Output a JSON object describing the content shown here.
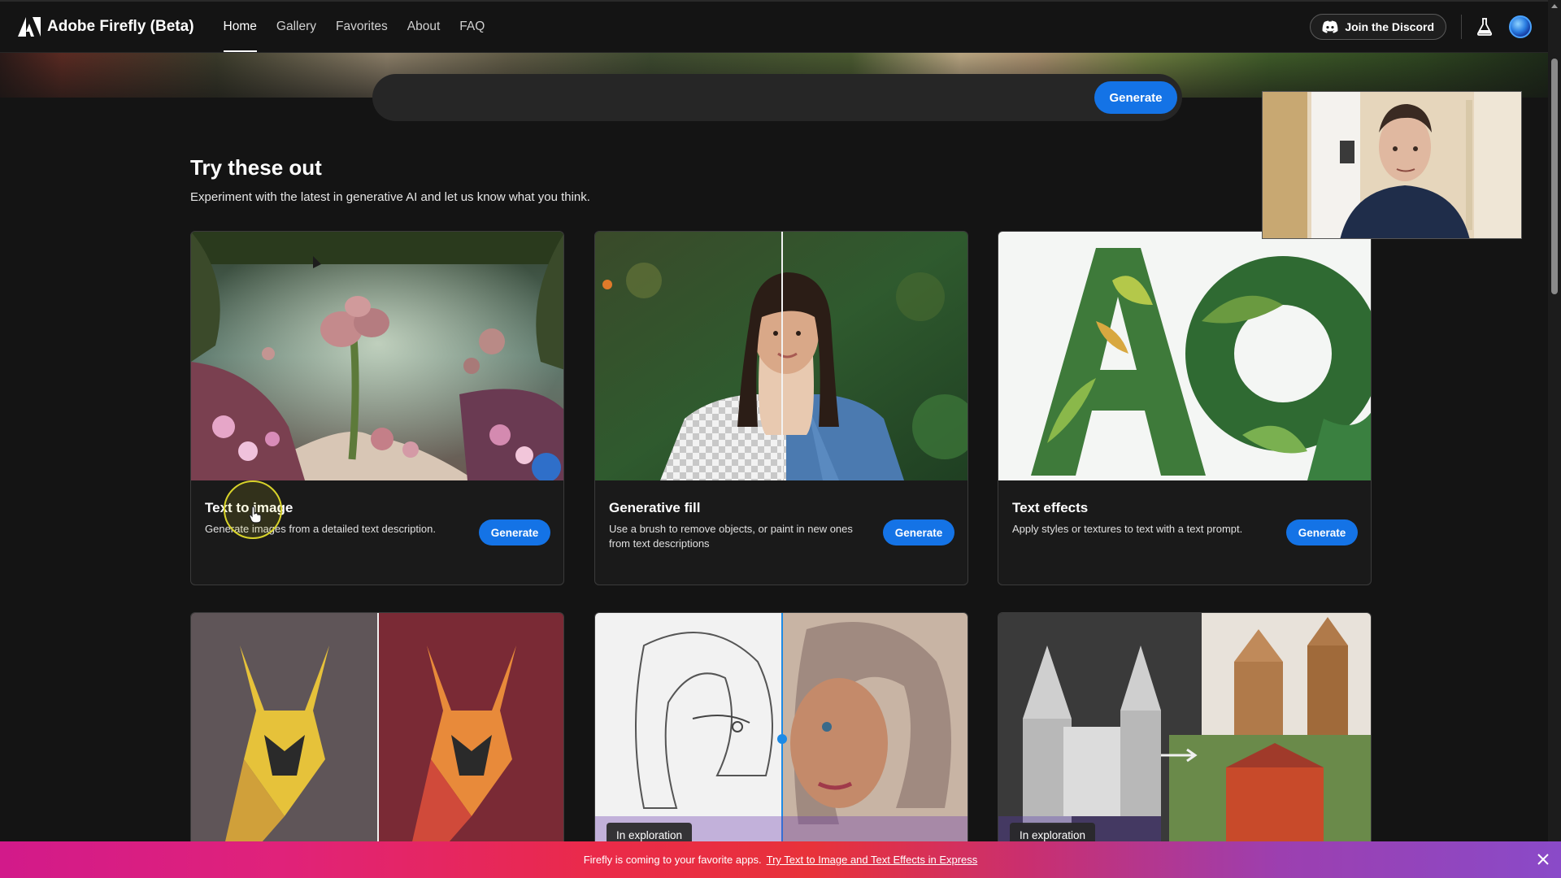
{
  "app": {
    "brand": "Adobe Firefly (Beta)"
  },
  "nav": {
    "links": [
      {
        "label": "Home",
        "active": true
      },
      {
        "label": "Gallery",
        "active": false
      },
      {
        "label": "Favorites",
        "active": false
      },
      {
        "label": "About",
        "active": false
      },
      {
        "label": "FAQ",
        "active": false
      }
    ],
    "discord_label": "Join the Discord"
  },
  "prompt": {
    "placeholder": "",
    "generate_label": "Generate"
  },
  "section": {
    "title": "Try these out",
    "subtitle": "Experiment with the latest in generative AI and let us know what you think."
  },
  "cards": [
    {
      "title": "Text to image",
      "desc": "Generate images from a detailed text description.",
      "button": "Generate"
    },
    {
      "title": "Generative fill",
      "desc": "Use a brush to remove objects, or paint in new ones from text descriptions",
      "button": "Generate"
    },
    {
      "title": "Text effects",
      "desc": "Apply styles or textures to text with a text prompt.",
      "button": "Generate"
    }
  ],
  "cards_row2": [
    {
      "badge": ""
    },
    {
      "badge": "In exploration"
    },
    {
      "badge": "In exploration"
    }
  ],
  "banner": {
    "text": "Firefly is coming to your favorite apps.",
    "link": "Try Text to Image and Text Effects in Express"
  },
  "colors": {
    "accent": "#1473e6",
    "background": "#141414",
    "card_border": "#3b3b3b"
  }
}
